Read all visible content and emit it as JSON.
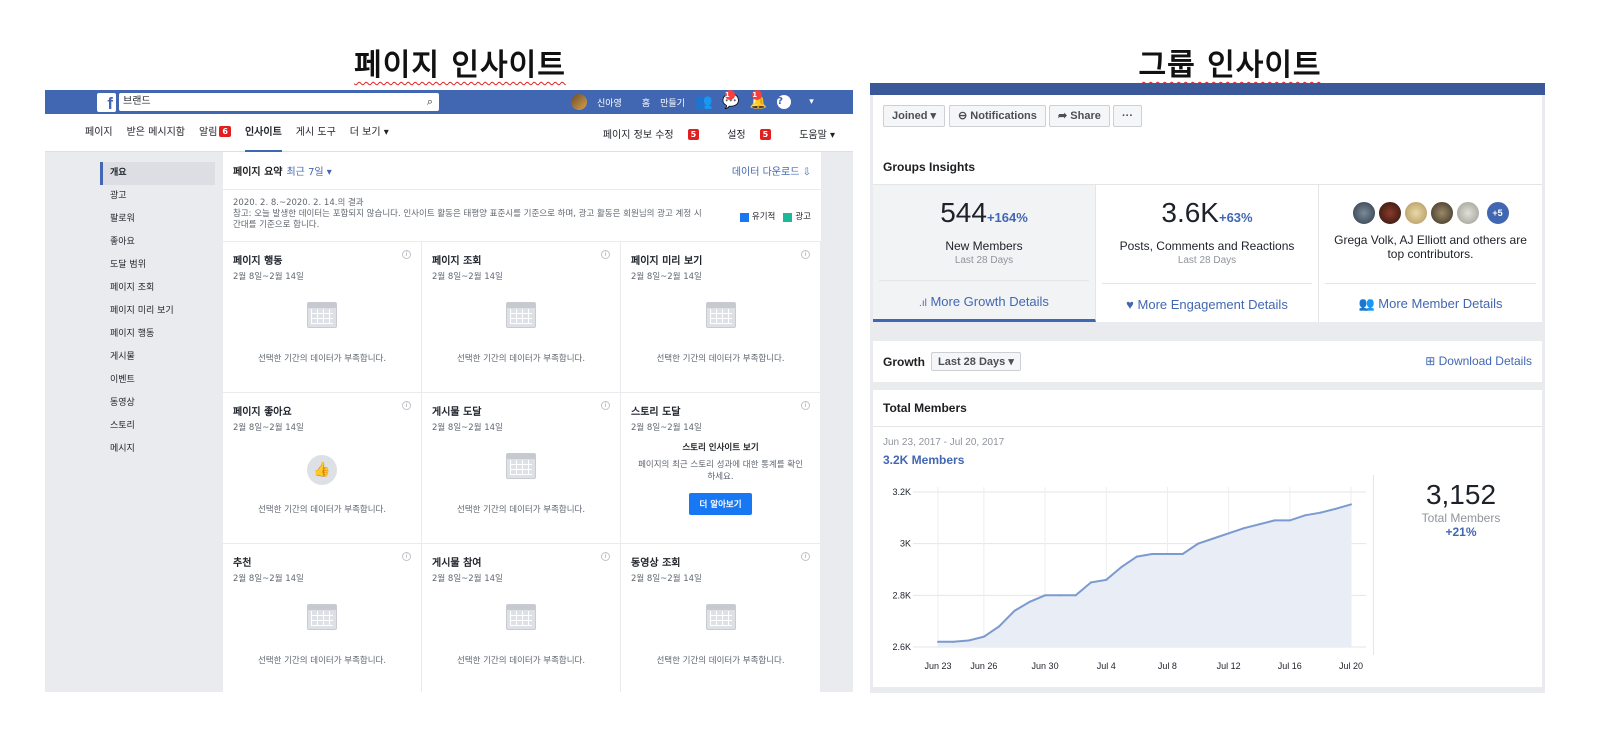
{
  "titles": {
    "left": "페이지 인사이트",
    "right": "그룹 인사이트"
  },
  "fb": {
    "logo": "f",
    "search_value": "브랜드",
    "nav": {
      "user": "신아영",
      "home": "홈",
      "create": "만들기",
      "msg_count": "1",
      "notif_count": "1"
    }
  },
  "tabs": [
    {
      "label": "페이지",
      "badge": ""
    },
    {
      "label": "받은 메시지함",
      "badge": ""
    },
    {
      "label": "알림",
      "badge": "6"
    },
    {
      "label": "인사이트",
      "badge": ""
    },
    {
      "label": "게시 도구",
      "badge": ""
    },
    {
      "label": "더 보기 ▾",
      "badge": ""
    }
  ],
  "tabs_right": [
    {
      "label": "페이지 정보 수정",
      "badge": "5"
    },
    {
      "label": "설정",
      "badge": "5"
    },
    {
      "label": "도움말 ▾",
      "badge": ""
    }
  ],
  "sidebar": [
    "개요",
    "광고",
    "팔로워",
    "좋아요",
    "도달 범위",
    "페이지 조회",
    "페이지 미리 보기",
    "페이지 행동",
    "게시물",
    "이벤트",
    "동영상",
    "스토리",
    "메시지"
  ],
  "summary": {
    "title": "페이지 요약",
    "period": "최근 7일 ▾",
    "download": "데이터 다운로드",
    "range": "2020. 2. 8.~2020. 2. 14.의 결과",
    "note": "참고: 오늘 발생한 데이터는 포함되지 않습니다. 인사이트 활동은 태평양 표준시를 기준으로 하며, 광고 활동은 회원님의 광고 계정 시간대를 기준으로 합니다.",
    "legend_organic": "유기적",
    "legend_ad": "광고"
  },
  "cells": [
    {
      "title": "페이지 행동",
      "date": "2월 8일~2월 14일",
      "kind": "cal",
      "empty": "선택한 기간의 데이터가 부족합니다."
    },
    {
      "title": "페이지 조회",
      "date": "2월 8일~2월 14일",
      "kind": "cal",
      "empty": "선택한 기간의 데이터가 부족합니다."
    },
    {
      "title": "페이지 미리 보기",
      "date": "2월 8일~2월 14일",
      "kind": "cal",
      "empty": "선택한 기간의 데이터가 부족합니다."
    },
    {
      "title": "페이지 좋아요",
      "date": "2월 8일~2월 14일",
      "kind": "thumb",
      "empty": "선택한 기간의 데이터가 부족합니다."
    },
    {
      "title": "게시물 도달",
      "date": "2월 8일~2월 14일",
      "kind": "cal",
      "empty": "선택한 기간의 데이터가 부족합니다."
    },
    {
      "title": "스토리 도달",
      "date": "2월 8일~2월 14일",
      "kind": "story",
      "story_title": "스토리 인사이트 보기",
      "story_text": "페이지의 최근 스토리 성과에 대한 통계를 확인하세요.",
      "story_button": "더 알아보기"
    },
    {
      "title": "추천",
      "date": "2월 8일~2월 14일",
      "kind": "cal",
      "empty": "선택한 기간의 데이터가 부족합니다."
    },
    {
      "title": "게시물 참여",
      "date": "2월 8일~2월 14일",
      "kind": "cal",
      "empty": "선택한 기간의 데이터가 부족합니다."
    },
    {
      "title": "동영상 조회",
      "date": "2월 8일~2월 14일",
      "kind": "cal",
      "empty": "선택한 기간의 데이터가 부족합니다."
    }
  ],
  "group": {
    "buttons": {
      "joined": "Joined ▾",
      "notifications": "Notifications",
      "share": "Share",
      "more": "···"
    },
    "insights_title": "Groups Insights",
    "stats": [
      {
        "value": "544",
        "pct": "+164%",
        "label": "New Members",
        "sub": "Last 28 Days",
        "link": "More Growth Details"
      },
      {
        "value": "3.6K",
        "pct": "+63%",
        "label": "Posts, Comments and Reactions",
        "sub": "Last 28 Days",
        "link": "More Engagement Details"
      },
      {
        "avatars_more": "+5",
        "label": "Grega Volk, AJ Elliott and others are top contributors.",
        "link": "More Member Details"
      }
    ],
    "growth": {
      "label": "Growth",
      "range": "Last 28 Days ▾",
      "download": "Download Details"
    },
    "members": {
      "title": "Total Members",
      "range": "Jun 23, 2017 - Jul 20, 2017",
      "count_label": "3.2K Members",
      "total": "3,152",
      "total_label": "Total Members",
      "total_pct": "+21%"
    }
  },
  "colors": {
    "fb_blue": "#4267b2",
    "red_badge": "#e02020",
    "organic": "#1877f2",
    "ad": "#1bb99a",
    "line": "#7b9ad0",
    "fill": "#e8edf6"
  },
  "chart_data": {
    "type": "area",
    "title": "Total Members",
    "x_ticks": [
      "Jun 23",
      "Jun 26",
      "Jun 30",
      "Jul 4",
      "Jul 8",
      "Jul 12",
      "Jul 16",
      "Jul 20"
    ],
    "y_ticks": [
      "3.2K",
      "3K",
      "2.8K",
      "2.6K"
    ],
    "ylim": [
      2600,
      3200
    ],
    "x": [
      "Jun 23",
      "Jun 24",
      "Jun 25",
      "Jun 26",
      "Jun 27",
      "Jun 28",
      "Jun 29",
      "Jun 30",
      "Jul 1",
      "Jul 2",
      "Jul 3",
      "Jul 4",
      "Jul 5",
      "Jul 6",
      "Jul 7",
      "Jul 8",
      "Jul 9",
      "Jul 10",
      "Jul 11",
      "Jul 12",
      "Jul 13",
      "Jul 14",
      "Jul 15",
      "Jul 16",
      "Jul 17",
      "Jul 18",
      "Jul 19",
      "Jul 20"
    ],
    "values": [
      2620,
      2620,
      2625,
      2640,
      2680,
      2740,
      2775,
      2800,
      2800,
      2800,
      2850,
      2860,
      2910,
      2950,
      2960,
      2960,
      2960,
      3000,
      3020,
      3040,
      3060,
      3075,
      3090,
      3090,
      3110,
      3120,
      3135,
      3152
    ],
    "grid": true
  }
}
